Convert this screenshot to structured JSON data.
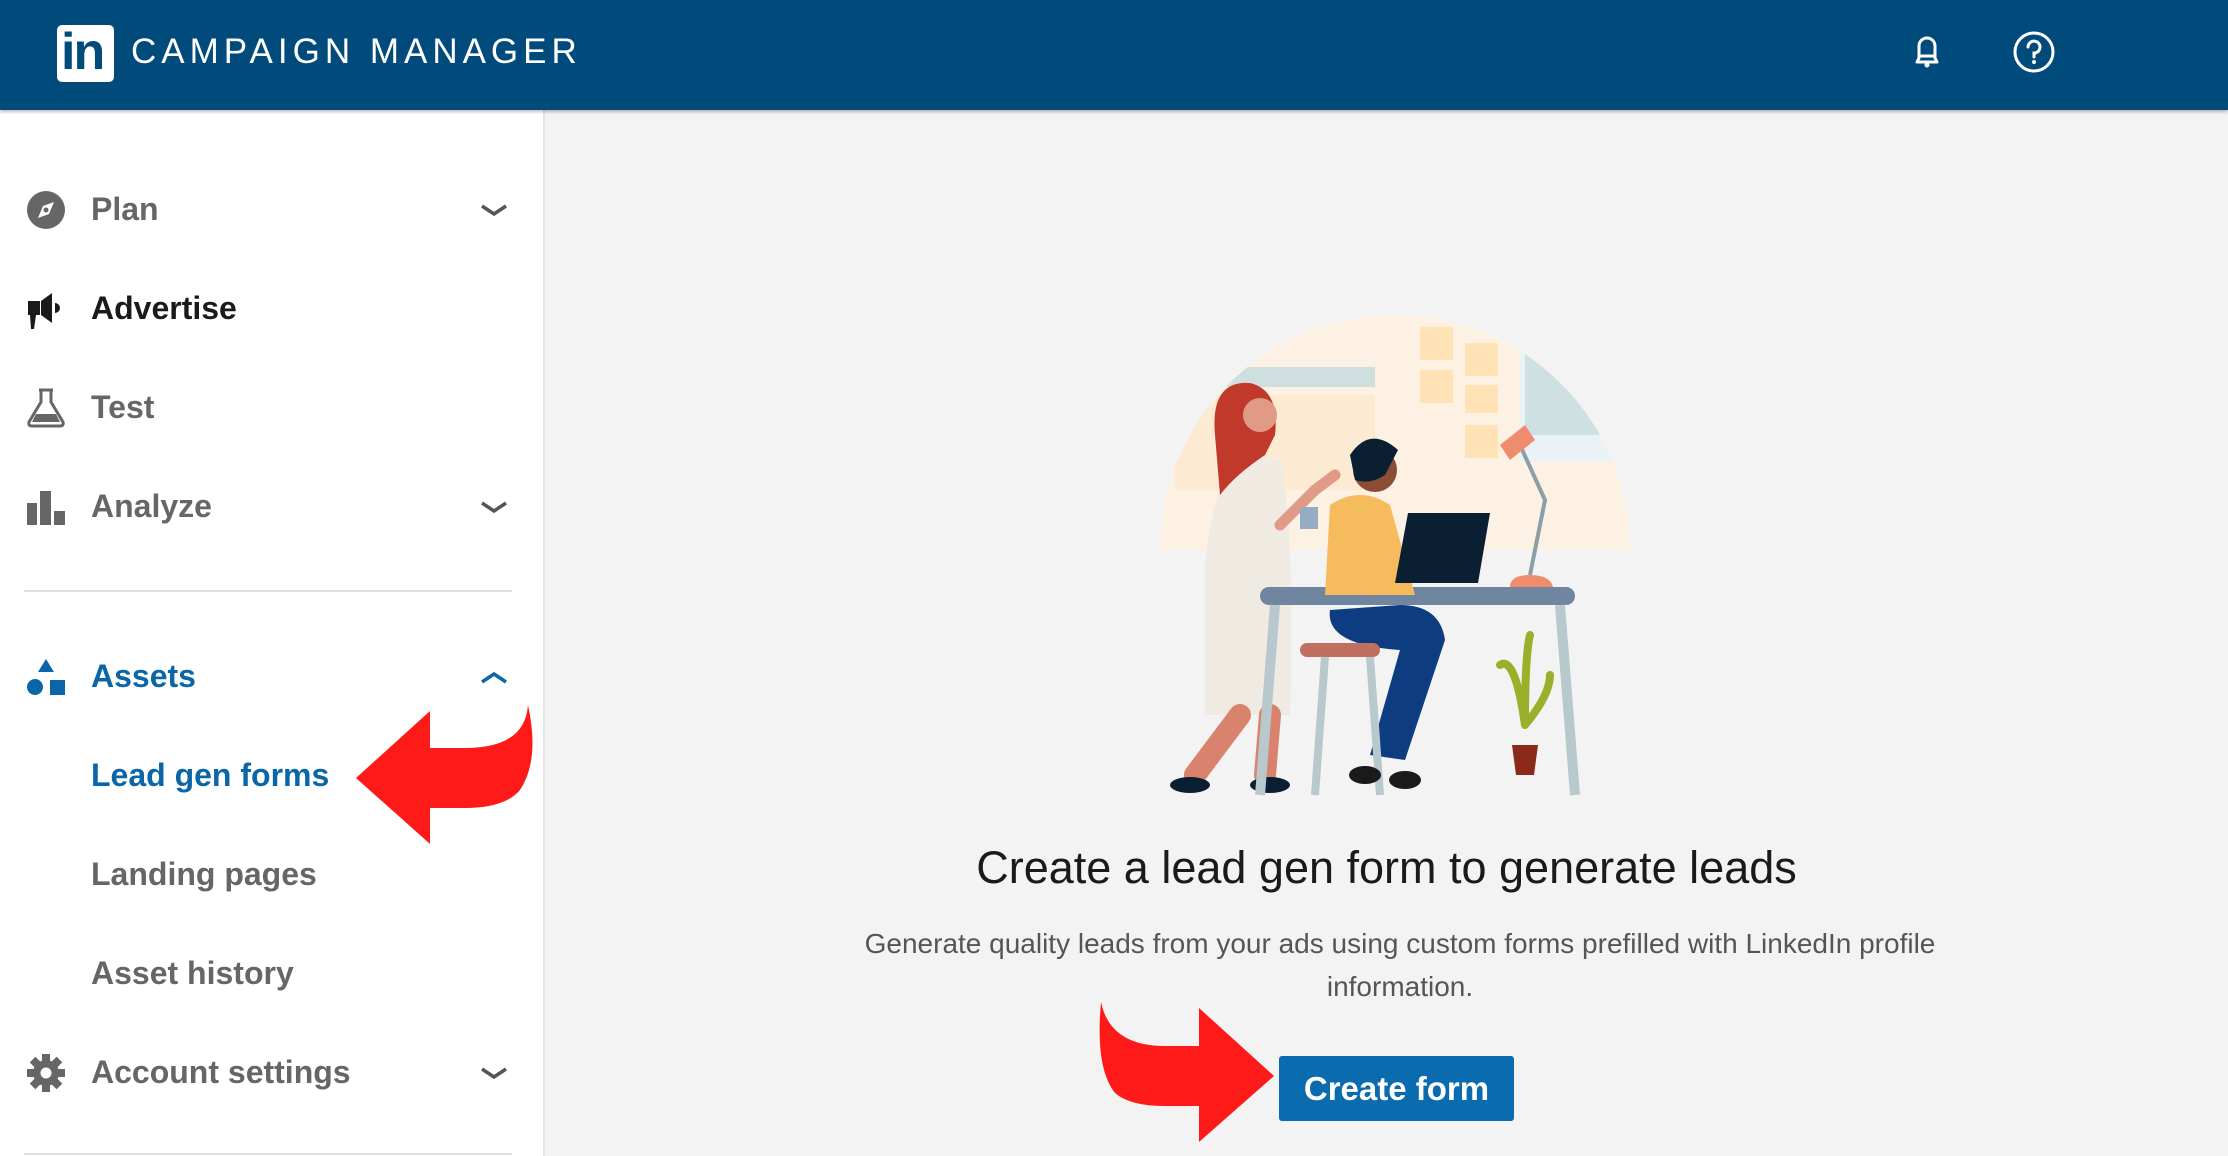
{
  "header": {
    "logo_text": "in",
    "app_title": "CAMPAIGN MANAGER",
    "icons": [
      "bell-icon",
      "help-icon"
    ]
  },
  "sidebar": {
    "items": [
      {
        "label": "Plan",
        "icon": "compass-icon",
        "chevron": "down"
      },
      {
        "label": "Advertise",
        "icon": "megaphone-icon",
        "state": "active"
      },
      {
        "label": "Test",
        "icon": "flask-icon"
      },
      {
        "label": "Analyze",
        "icon": "bar-chart-icon",
        "chevron": "down"
      },
      {
        "label": "Assets",
        "icon": "shapes-icon",
        "chevron": "up",
        "state": "expanded"
      },
      {
        "label": "Lead gen forms",
        "state": "selected"
      },
      {
        "label": "Landing pages"
      },
      {
        "label": "Asset history"
      },
      {
        "label": "Account settings",
        "icon": "gear-icon",
        "chevron": "down"
      }
    ]
  },
  "main": {
    "illustration": "office-collaboration-illustration",
    "heading": "Create a lead gen form to generate leads",
    "description": "Generate quality leads from your ads using custom forms prefilled with LinkedIn profile information.",
    "cta_label": "Create form"
  },
  "annotations": {
    "arrow_color": "#ff1a1a",
    "arrows": [
      "points-to-lead-gen-forms",
      "points-to-create-form-button"
    ]
  },
  "colors": {
    "header_bg": "#004b7c",
    "accent_blue": "#0a66a8",
    "button_bg": "#0a6bae"
  }
}
